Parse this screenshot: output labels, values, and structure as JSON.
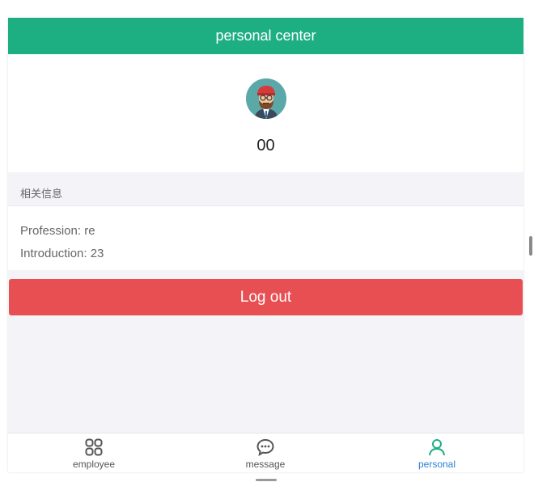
{
  "header": {
    "title": "personal center"
  },
  "profile": {
    "username": "00",
    "avatar_icon": "user-avatar-icon"
  },
  "section": {
    "title": "相关信息"
  },
  "info": {
    "profession": "Profession: re",
    "introduction": "Introduction: 23"
  },
  "actions": {
    "logout_label": "Log out"
  },
  "tabbar": {
    "items": [
      {
        "label": "employee",
        "icon": "grid-icon",
        "active": false
      },
      {
        "label": "message",
        "icon": "chat-bubble-icon",
        "active": false
      },
      {
        "label": "personal",
        "icon": "person-icon",
        "active": true
      }
    ]
  },
  "colors": {
    "header_bg": "#1daf82",
    "logout_bg": "#e84f52",
    "active_tab_text": "#2b7fd6",
    "active_tab_icon": "#1daf82"
  }
}
